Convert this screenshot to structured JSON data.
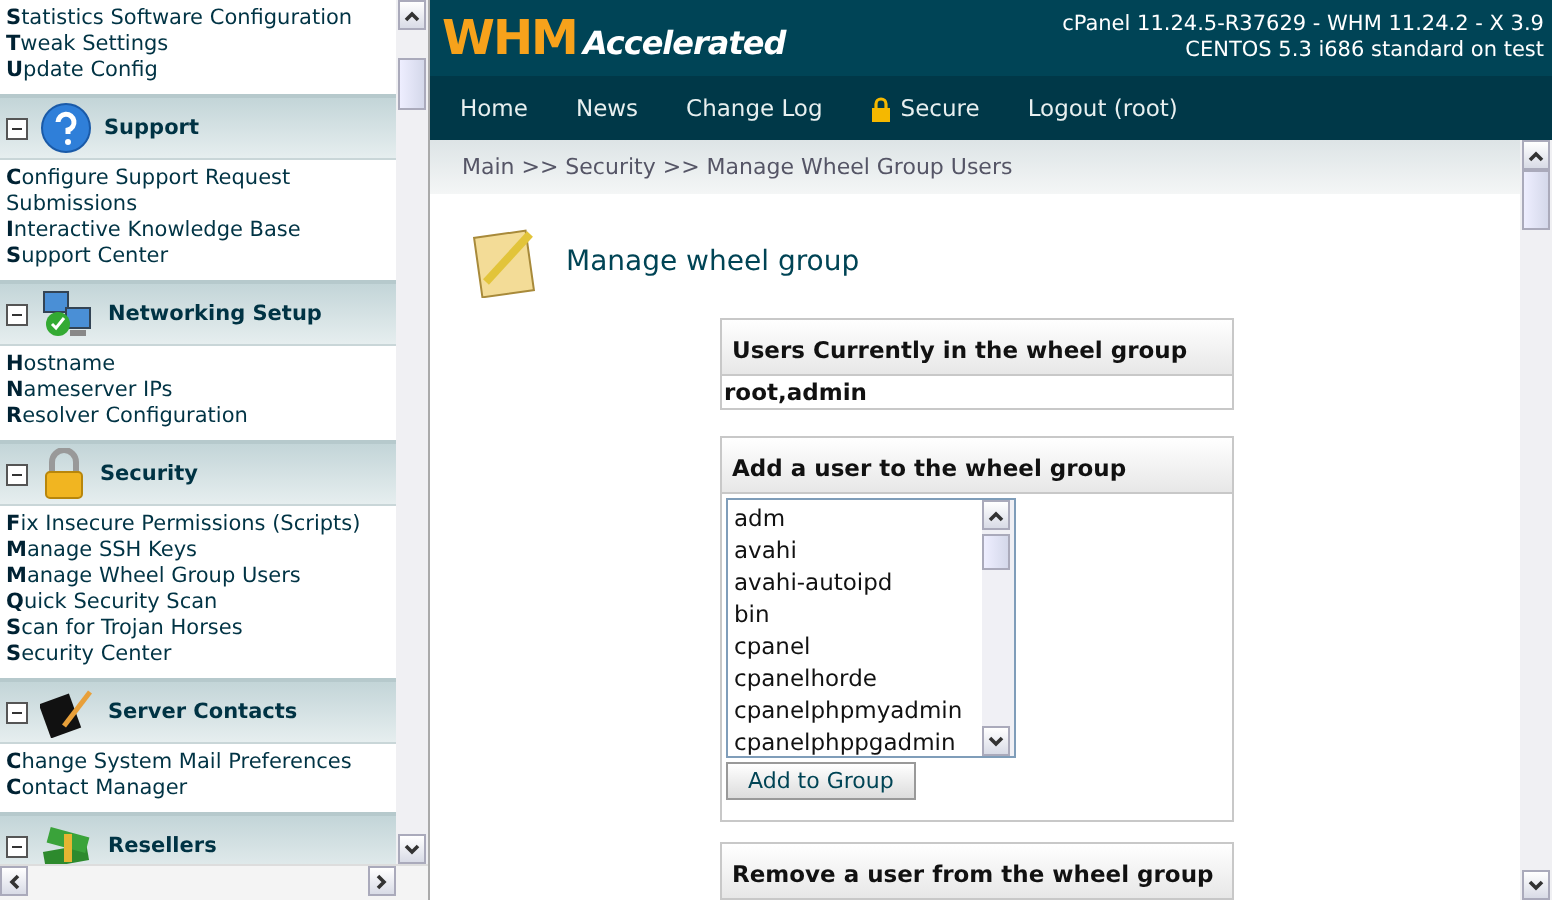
{
  "sidebar": {
    "sections": [
      {
        "kind": "items",
        "items": [
          "**S**tatistics Software Configuration",
          "**T**weak Settings",
          "**U**pdate Config"
        ]
      },
      {
        "kind": "section",
        "title": "Support",
        "expanded": true,
        "items": [
          "**C**onfigure Support Request Submissions",
          "**I**nteractive Knowledge Base",
          "**S**upport Center"
        ]
      },
      {
        "kind": "section",
        "title": "Networking Setup",
        "expanded": true,
        "items": [
          "**H**ostname",
          "**N**ameserver IPs",
          "**R**esolver Configuration"
        ]
      },
      {
        "kind": "section",
        "title": "Security",
        "expanded": true,
        "items": [
          "**F**ix Insecure Permissions (Scripts)",
          "**M**anage SSH Keys",
          "**M**anage Wheel Group Users",
          "**Q**uick Security Scan",
          "**S**can for Trojan Horses",
          "**S**ecurity Center"
        ]
      },
      {
        "kind": "section",
        "title": "Server Contacts",
        "expanded": true,
        "items": [
          "**C**hange System Mail Preferences",
          "**C**ontact Manager"
        ]
      },
      {
        "kind": "section",
        "title": "Resellers",
        "expanded": true
      }
    ]
  },
  "header": {
    "logo_main": "WHM",
    "logo_sub": "Accelerated",
    "version_lines": [
      "cPanel 11.24.5-R37629 - WHM 11.24.2 - X 3.9",
      "CENTOS 5.3 i686 standard on test"
    ]
  },
  "nav": [
    {
      "label": "Home",
      "lock": false
    },
    {
      "label": "News",
      "lock": false
    },
    {
      "label": "Change Log",
      "lock": false
    },
    {
      "label": "Secure",
      "lock": true
    },
    {
      "label": "Logout (root)",
      "lock": false
    }
  ],
  "breadcrumb": "Main >> Security >> Manage Wheel Group Users",
  "page_title": "Manage wheel group",
  "current_users": {
    "heading": "Users Currently in the wheel group",
    "value": "root,admin"
  },
  "add_user": {
    "heading": "Add a user to the wheel group",
    "options": [
      "adm",
      "avahi",
      "avahi-autoipd",
      "bin",
      "cpanel",
      "cpanelhorde",
      "cpanelphpmyadmin",
      "cpanelphppgadmin"
    ],
    "button": "Add to Group"
  },
  "remove_user": {
    "heading": "Remove a user from the wheel group"
  }
}
